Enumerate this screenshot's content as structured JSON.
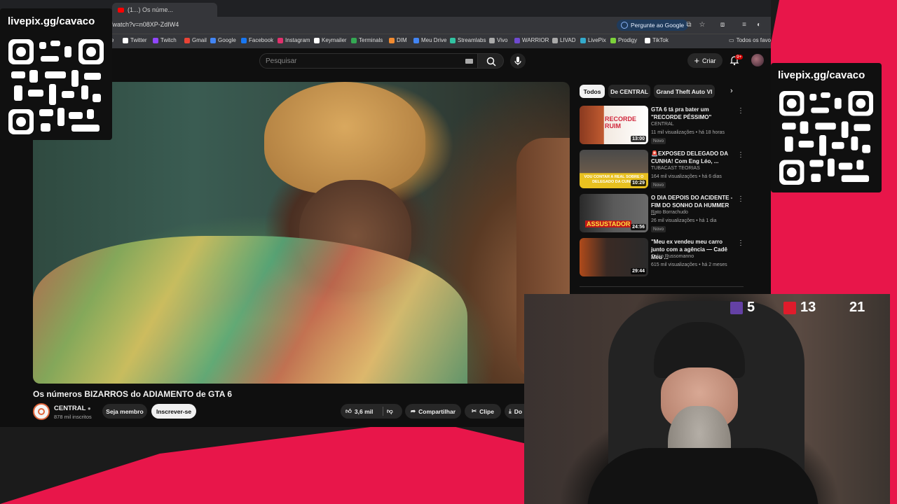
{
  "overlay": {
    "livepix_left": "livepix.gg/cavaco",
    "livepix_right": "livepix.gg/cavaco",
    "stats": [
      {
        "icon": "twitch-icon",
        "value": "5"
      },
      {
        "icon": "youtube-live-icon",
        "value": "13"
      },
      {
        "icon": "viewer-icon",
        "value": "21"
      }
    ]
  },
  "browser": {
    "tab_title": "(1...) Os núme...",
    "url": "/watch?v=n08XP-ZdIW4",
    "google_button": "Pergunte ao Google",
    "bookmarks": [
      "e",
      "Twitter",
      "Twitch",
      "Gmail",
      "Google",
      "Facebook",
      "Instagram",
      "Keymailer",
      "Terminals",
      "DIM",
      "Meu Drive",
      "Streamlabs",
      "Vivo",
      "WARRIOR",
      "LIVAD",
      "LivePix",
      "Prodigy",
      "TikTok"
    ],
    "bookmarks_other": "Todos os favor"
  },
  "youtube": {
    "search_placeholder": "Pesquisar",
    "create_label": "Criar",
    "notifications": "9+",
    "video_title": "Os números BIZARROS do ADIAMENTO de GTA 6",
    "channel_name": "CENTRAL",
    "channel_subs": "878 mil inscritos",
    "member_button": "Seja membro",
    "subscribe_button": "Inscrever-se",
    "likes": "3,6 mil",
    "share": "Compartilhar",
    "clip": "Clipe",
    "download": "Do",
    "chips": [
      "Todos",
      "De CENTRAL",
      "Grand Theft Auto VI"
    ],
    "related": [
      {
        "title": "GTA 6 tá pra bater um \"RECORDE PÉSSIMO\"",
        "channel": "CENTRAL",
        "meta": "11 mil visualizações • há 18 horas",
        "badge": "Novo",
        "duration": "13:00",
        "thumb_text": "RECORDE RUIM"
      },
      {
        "title": "🚨EXPOSED DELEGADO DA CUNHA! Com Eng Léo, ...",
        "channel": "TUBACAST TEORIAS",
        "meta": "164 mil visualizações • há 6 dias",
        "badge": "Novo",
        "duration": "10:29",
        "thumb_text": "VOU CONTAR A REAL SOBRE O DELEGADO DA CUNHA"
      },
      {
        "title": "O DIA DEPOIS DO ACIDENTE - FIM DO SONHO DA HUMMER ...",
        "channel": "Rato Borrachudo",
        "meta": "26 mil visualizações • há 1 dia",
        "badge": "Novo",
        "duration": "24:56",
        "thumb_text": "ASSUSTADOR"
      },
      {
        "title": "\"Meu ex vendeu meu carro junto com a agência — Cadê Meu ...",
        "channel": "Celso Russomanno",
        "meta": "615 mil visualizações • há 2 meses",
        "badge": "",
        "duration": "29:44",
        "thumb_text": ""
      }
    ]
  },
  "colors": {
    "accent": "#e8164a",
    "yt_red": "#cc0000"
  }
}
